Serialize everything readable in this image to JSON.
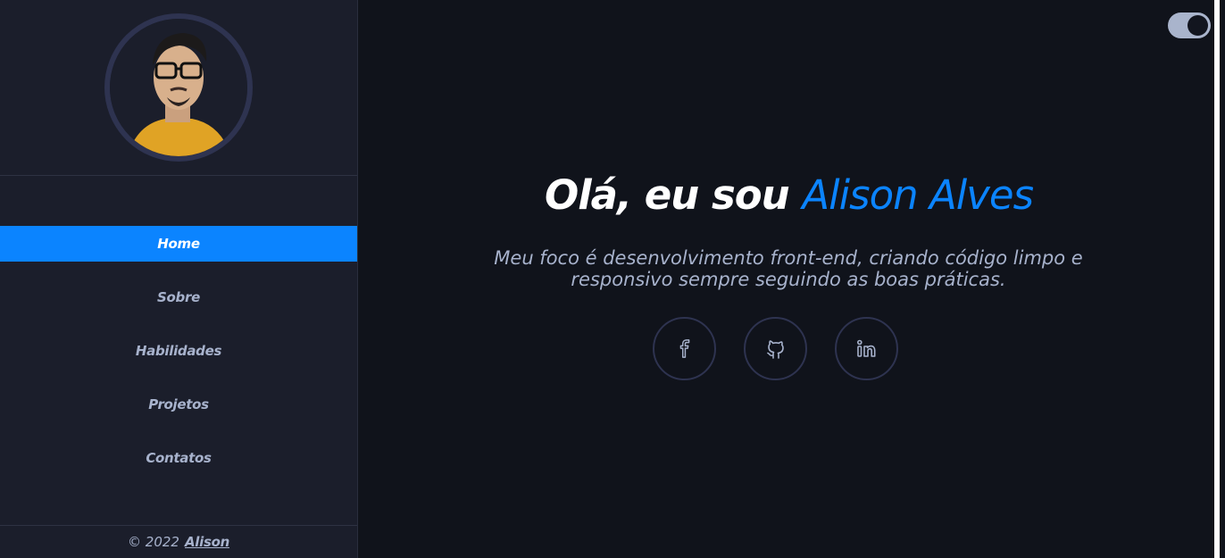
{
  "sidebar": {
    "avatar_alt": "Alison Alves",
    "nav": [
      {
        "label": "Home",
        "active": true
      },
      {
        "label": "Sobre",
        "active": false
      },
      {
        "label": "Habilidades",
        "active": false
      },
      {
        "label": "Projetos",
        "active": false
      },
      {
        "label": "Contatos",
        "active": false
      }
    ],
    "footer": {
      "copyright": "© 2022",
      "author_link": "Alison"
    }
  },
  "theme_toggle": {
    "state": "dark",
    "icon": "toggle-switch"
  },
  "hero": {
    "greeting": "Olá, eu sou",
    "name": "Alison Alves",
    "description": "Meu foco é desenvolvimento front-end, criando código limpo e responsivo sempre seguindo as boas práticas."
  },
  "socials": [
    {
      "icon": "facebook-icon"
    },
    {
      "icon": "github-icon"
    },
    {
      "icon": "linkedin-icon"
    }
  ],
  "colors": {
    "accent": "#0b84ff",
    "sidebar_bg": "#1b1e2b",
    "main_bg": "#10131b",
    "muted_text": "#a7b2cc"
  }
}
